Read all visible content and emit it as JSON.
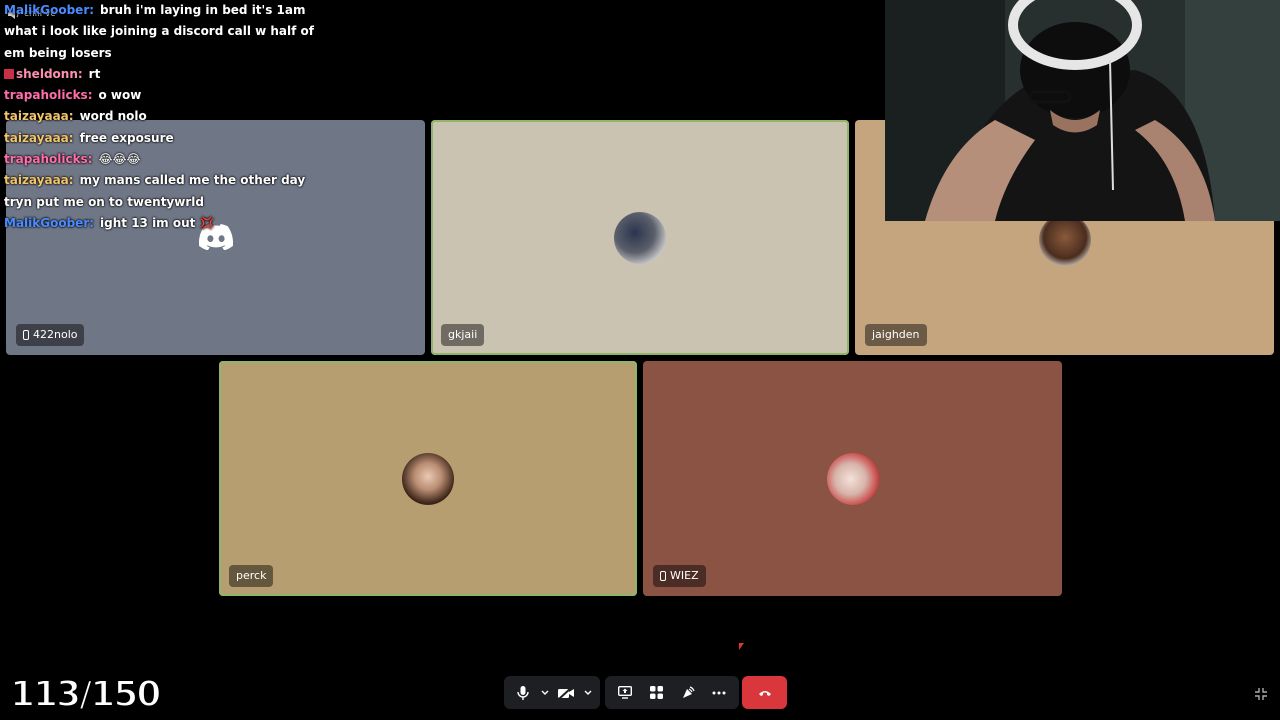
{
  "channel": {
    "name": "chill vc",
    "icon": "speaker-icon"
  },
  "chat": [
    {
      "user": "MalikGoober:",
      "color": "#4a8cff",
      "text": "bruh i'm laying in bed it's 1am"
    },
    {
      "user": "",
      "color": "#ffffff",
      "text": "what i look like joining a discord call w half of"
    },
    {
      "user": "",
      "color": "#ffffff",
      "text": "em being losers"
    },
    {
      "user": "sheldonn:",
      "color": "#ffffff",
      "text": "rt",
      "badge": "pencil-icon"
    },
    {
      "user": "trapaholicks:",
      "color": "#ff6ea8",
      "text": "o wow"
    },
    {
      "user": "taizayaaa:",
      "color": "#f2c46b",
      "text": "word nolo"
    },
    {
      "user": "taizayaaa:",
      "color": "#f2c46b",
      "text": "free exposure"
    },
    {
      "user": "trapaholicks:",
      "color": "#ff6ea8",
      "text": "😂😂😂"
    },
    {
      "user": "taizayaaa:",
      "color": "#f2c46b",
      "text": "my mans called me the other day"
    },
    {
      "user": "",
      "color": "#ffffff",
      "text": "tryn put me on to twentywrld"
    },
    {
      "user": "MalikGoober:",
      "color": "#4a8cff",
      "text": "ight 13 im out 💢"
    }
  ],
  "participants": [
    {
      "name": "422nolo",
      "mobile": true,
      "bg": "#6f7686",
      "speaking": false,
      "avatar": "discord-logo"
    },
    {
      "name": "gkjaii",
      "mobile": false,
      "bg": "#cbc3b2",
      "speaking": true,
      "avatar": "photo"
    },
    {
      "name": "jaighden",
      "mobile": false,
      "bg": "#c4a57e",
      "speaking": false,
      "avatar": "photo"
    },
    {
      "name": "perck",
      "mobile": false,
      "bg": "#b69e70",
      "speaking": true,
      "avatar": "photo"
    },
    {
      "name": "WIEZ",
      "mobile": true,
      "bg": "#8a5344",
      "speaking": false,
      "avatar": "photo"
    }
  ],
  "counter": "113/150",
  "controls": {
    "mic": "microphone-icon",
    "camera": "camera-off-icon",
    "share": "screen-share-icon",
    "activities": "activities-icon",
    "soundboard": "soundboard-icon",
    "more": "more-icon",
    "hangup": "hangup-icon",
    "collapse": "collapse-icon"
  }
}
